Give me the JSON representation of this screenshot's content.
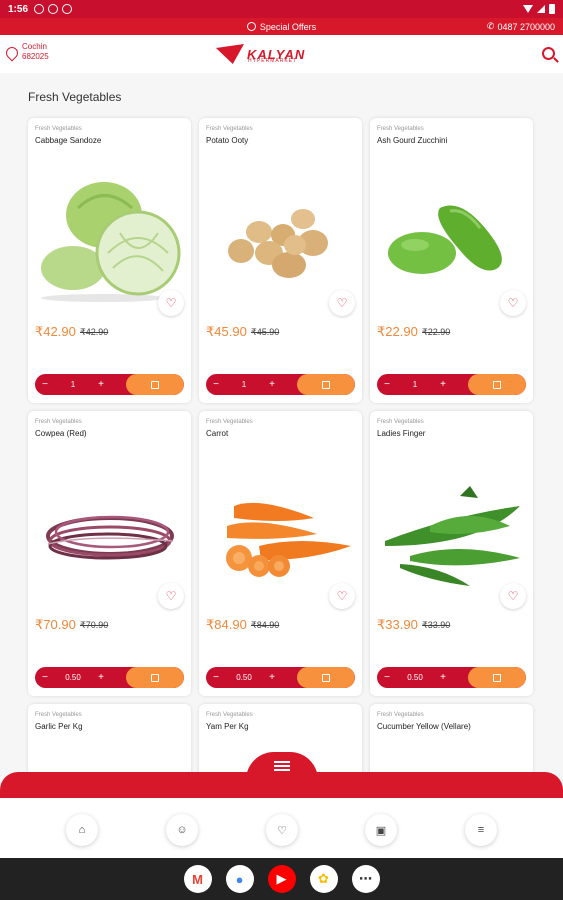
{
  "status_bar": {
    "time": "1:56"
  },
  "offer_bar": {
    "label": "Special Offers",
    "phone": "0487 2700000"
  },
  "header": {
    "location_city": "Cochin",
    "location_pin": "682025",
    "logo_text": "KALYAN",
    "logo_sub": "HYPERMARKET"
  },
  "section": {
    "title": "Fresh Vegetables"
  },
  "products": [
    {
      "category": "Fresh Vegetables",
      "name": "Cabbage Sandoze",
      "price": "₹42.90",
      "old_price": "₹42.90",
      "qty": "1",
      "image": "cabbage"
    },
    {
      "category": "Fresh Vegetables",
      "name": "Potato Ooty",
      "price": "₹45.90",
      "old_price": "₹45.90",
      "qty": "1",
      "image": "potato"
    },
    {
      "category": "Fresh Vegetables",
      "name": "Ash Gourd Zucchini",
      "price": "₹22.90",
      "old_price": "₹22.90",
      "qty": "1",
      "image": "zucchini"
    },
    {
      "category": "Fresh Vegetables",
      "name": "Cowpea (Red)",
      "price": "₹70.90",
      "old_price": "₹70.90",
      "qty": "0.50",
      "image": "cowpea"
    },
    {
      "category": "Fresh Vegetables",
      "name": "Carrot",
      "price": "₹84.90",
      "old_price": "₹84.90",
      "qty": "0.50",
      "image": "carrot"
    },
    {
      "category": "Fresh Vegetables",
      "name": "Ladies Finger",
      "price": "₹33.90",
      "old_price": "₹33.90",
      "qty": "0.50",
      "image": "okra"
    },
    {
      "category": "Fresh Vegetables",
      "name": "Garlic Per Kg"
    },
    {
      "category": "Fresh Vegetables",
      "name": "Yam Per Kg"
    },
    {
      "category": "Fresh Vegetables",
      "name": "Cucumber Yellow (Vellare)"
    }
  ],
  "qty_controls": {
    "minus": "−",
    "plus": "+"
  },
  "bottom_nav": [
    {
      "icon": "home-icon",
      "glyph": "⌂"
    },
    {
      "icon": "profile-icon",
      "glyph": "☺"
    },
    {
      "icon": "wishlist-icon",
      "glyph": "♡"
    },
    {
      "icon": "orders-icon",
      "glyph": "▣"
    },
    {
      "icon": "menu-icon",
      "glyph": "≡"
    }
  ],
  "system_apps": [
    {
      "name": "gmail-icon",
      "glyph": "M",
      "color": "#ea4335",
      "bg": "#ffffff"
    },
    {
      "name": "chrome-icon",
      "glyph": "●",
      "color": "#4285f4",
      "bg": "#ffffff"
    },
    {
      "name": "youtube-icon",
      "glyph": "▶",
      "color": "#ffffff",
      "bg": "#ff0000"
    },
    {
      "name": "photos-icon",
      "glyph": "✿",
      "color": "#fbbc04",
      "bg": "#ffffff"
    },
    {
      "name": "apps-icon",
      "glyph": "⋯",
      "color": "#333333",
      "bg": "#ffffff"
    }
  ],
  "colors": {
    "brand": "#d7182a",
    "accent": "#f7913d",
    "price": "#f0883a"
  }
}
